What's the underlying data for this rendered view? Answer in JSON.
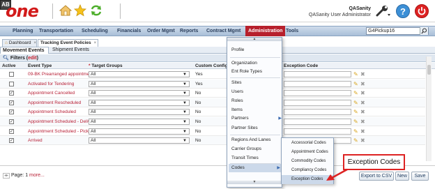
{
  "header": {
    "logo_text": "one",
    "user_name": "QASanity",
    "user_role": "QASanity User Administrator",
    "icons": [
      "home-icon",
      "star-icon",
      "refresh-icon",
      "ab-icon",
      "wrench-icon",
      "help-icon",
      "power-icon"
    ],
    "help_glyph": "?",
    "ab_glyph": "AB"
  },
  "nav": {
    "items": [
      "Planning",
      "Transportation",
      "Scheduling",
      "Financials",
      "Order Mgmt",
      "Reports",
      "Contract Mgmt",
      "Administration",
      "Tools"
    ],
    "active": "Administration",
    "search_value": "G4Pickup16"
  },
  "page_tabs": [
    {
      "label": "Dashboard",
      "close": "×"
    },
    {
      "label": "Tracking Event Policies",
      "close": "×"
    }
  ],
  "sub_tabs": [
    "Movement Events",
    "Shipment Events"
  ],
  "filters": {
    "label": "Filters",
    "edit": "edit"
  },
  "grid": {
    "columns": {
      "active": "Active",
      "event_type": "Event Type",
      "target_groups_req": "*",
      "target_groups": "Target Groups",
      "custom": "Custom Config",
      "exception_code": "Exception Code"
    },
    "rows": [
      {
        "checked": false,
        "event_type": "09-BK Prearranged appointment",
        "target_group": "All",
        "custom": "Yes"
      },
      {
        "checked": false,
        "event_type": "Activated for Tendering",
        "target_group": "All",
        "custom": "Yes"
      },
      {
        "checked": true,
        "event_type": "Appointment Cancelled",
        "target_group": "All",
        "custom": "No"
      },
      {
        "checked": true,
        "event_type": "Appointment Rescheduled",
        "target_group": "All",
        "custom": "No"
      },
      {
        "checked": true,
        "event_type": "Appointment Scheduled",
        "target_group": "All",
        "custom": "No"
      },
      {
        "checked": true,
        "event_type": "Appointment Scheduled - Delivery",
        "target_group": "All",
        "custom": "No"
      },
      {
        "checked": true,
        "event_type": "Appointment Scheduled - Pickup",
        "target_group": "All",
        "custom": "No"
      },
      {
        "checked": true,
        "event_type": "Arrived",
        "target_group": "All",
        "custom": "No"
      }
    ],
    "check_glyph": "✓"
  },
  "footer": {
    "page_label": "Page: 1",
    "more": "more...",
    "export_label": "Export to CSV",
    "new_label": "New",
    "save_label": "Save"
  },
  "admin_menu": {
    "items": [
      "Profile",
      "Organization",
      "Ent Role Types",
      "Sites",
      "Users",
      "Roles",
      "Items",
      "Partners",
      "Partner Sites",
      "Regions And Lanes",
      "Carrier Groups",
      "Transit Times",
      "Codes"
    ],
    "highlighted": "Codes"
  },
  "codes_menu": {
    "items": [
      "Accessorial Codes",
      "Appointment Codes",
      "Commodity Codes",
      "Compliancy Codes",
      "Exception Codes"
    ],
    "highlighted": "Exception Codes"
  },
  "callout": {
    "text": "Exception Codes",
    "color": "#dd2222"
  },
  "colors": {
    "brand_red": "#d21a1a",
    "nav_active": "#b7202c",
    "link_red": "#b71e34"
  }
}
